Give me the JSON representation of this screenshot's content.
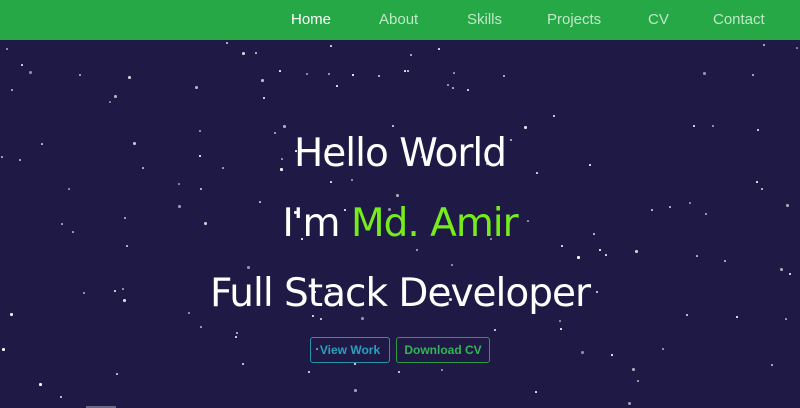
{
  "nav": {
    "items": [
      {
        "label": "Home",
        "active": true
      },
      {
        "label": "About",
        "active": false
      },
      {
        "label": "Skills",
        "active": false
      },
      {
        "label": "Projects",
        "active": false
      },
      {
        "label": "CV",
        "active": false
      },
      {
        "label": "Contact",
        "active": false
      }
    ]
  },
  "hero": {
    "greeting": "Hello World",
    "intro_prefix": "I'm ",
    "name": "Md. Amir",
    "role": "Full Stack Developer"
  },
  "buttons": {
    "view_work": "View Work",
    "download_cv": "Download CV"
  },
  "colors": {
    "navbar_bg": "#26a846",
    "page_bg": "#1e1a45",
    "name_accent": "#76ec1c",
    "view_work_accent": "#2aa0bd",
    "download_cv_accent": "#33b456"
  }
}
